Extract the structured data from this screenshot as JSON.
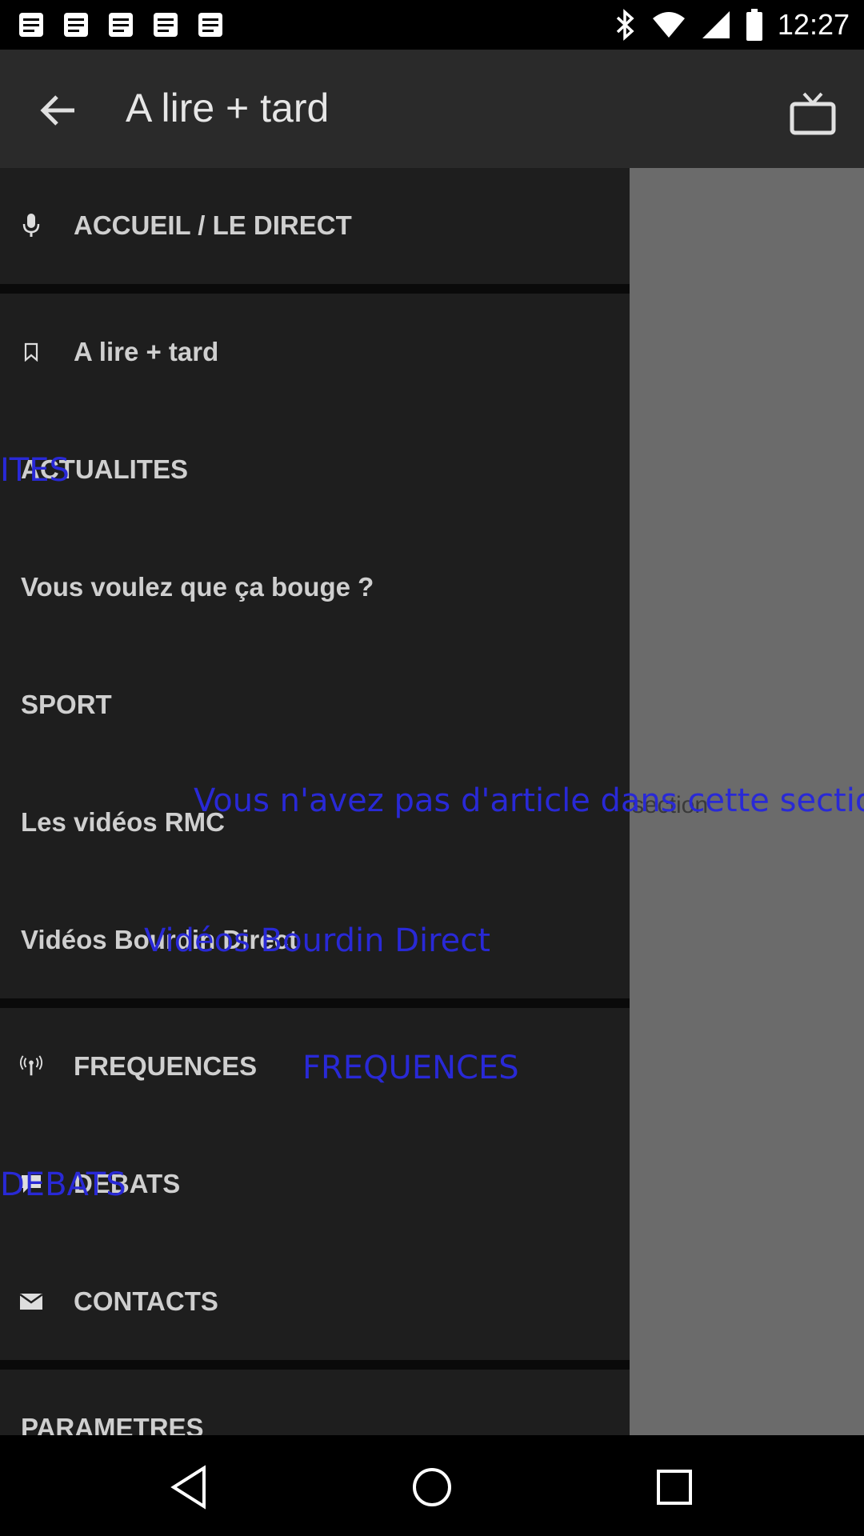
{
  "status_bar": {
    "time": "12:27",
    "left_icons": [
      "notification-icon",
      "notification-icon",
      "notification-icon",
      "notification-icon",
      "notification-icon"
    ],
    "right_icons": [
      "bluetooth-icon",
      "wifi-icon",
      "signal-icon",
      "battery-icon"
    ]
  },
  "app_bar": {
    "title": "A lire + tard",
    "back_icon": "arrow-back-icon",
    "tv_icon": "tv-icon"
  },
  "content": {
    "empty_message": "section"
  },
  "drawer": {
    "items": [
      {
        "label": "ACCUEIL / LE DIRECT",
        "icon": "microphone-icon"
      },
      {
        "label": "A lire + tard",
        "icon": "bookmark-icon"
      },
      {
        "label": "ACTUALITES"
      },
      {
        "label": "Vous voulez que ça bouge ?"
      },
      {
        "label": "SPORT"
      },
      {
        "label": "Les vidéos RMC"
      },
      {
        "label": "Vidéos Bourdin Direct"
      },
      {
        "label": "FREQUENCES",
        "icon": "antenna-icon"
      },
      {
        "label": "DEBATS",
        "icon": "chat-bubble-icon"
      },
      {
        "label": "CONTACTS",
        "icon": "envelope-icon"
      },
      {
        "label": "PARAMETRES"
      }
    ]
  },
  "overlays": {
    "actualites": "ITES",
    "empty_section": "Vous n'avez pas d'article dans cette section",
    "bourdin": "Vidéos Bourdin Direct",
    "frequences": "FREQUENCES",
    "debats": "DEBATS"
  },
  "nav_bar": {
    "back": "nav-back-icon",
    "home": "nav-home-icon",
    "recents": "nav-recents-icon"
  },
  "colors": {
    "app_bar": "#2a2a2a",
    "drawer": "#1e1e1e",
    "scrim": "#6b6b6b",
    "overlay_text": "#2929d6"
  }
}
